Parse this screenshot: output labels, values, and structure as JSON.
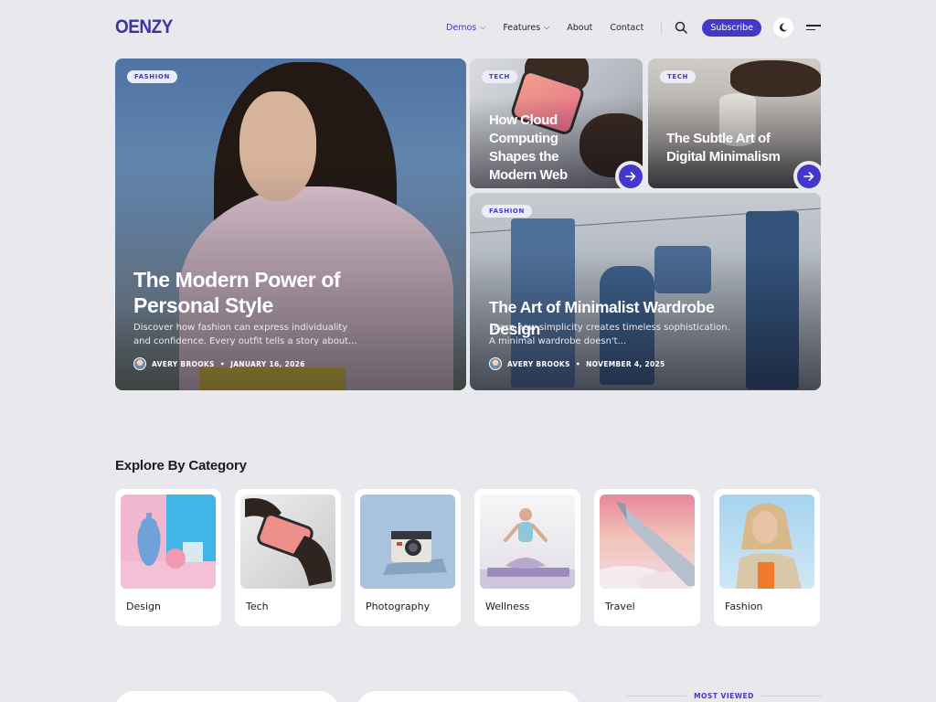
{
  "header": {
    "logo": "OENZY",
    "nav": [
      {
        "label": "Demos",
        "active": true,
        "has_dropdown": true
      },
      {
        "label": "Features",
        "active": false,
        "has_dropdown": true
      },
      {
        "label": "About",
        "active": false,
        "has_dropdown": false
      },
      {
        "label": "Contact",
        "active": false,
        "has_dropdown": false
      }
    ],
    "subscribe_label": "Subscribe",
    "icons": [
      "search-icon",
      "moon-icon",
      "menu-icon"
    ]
  },
  "hero": {
    "main": {
      "tag": "FASHION",
      "title": "The Modern Power of Personal Style",
      "excerpt": "Discover how fashion can express individuality and confidence. Every outfit tells a story about...",
      "author": "AVERY BROOKS",
      "date": "JANUARY 16, 2026"
    },
    "tech1": {
      "tag": "TECH",
      "title": "How Cloud Computing Shapes the Modern Web"
    },
    "tech2": {
      "tag": "TECH",
      "title": "The Subtle Art of Digital Minimalism"
    },
    "wardrobe": {
      "tag": "FASHION",
      "title": "The Art of Minimalist Wardrobe Design",
      "excerpt": "Learn how simplicity creates timeless sophistication. A minimal wardrobe doesn't...",
      "author": "AVERY BROOKS",
      "date": "NOVEMBER 4, 2025"
    }
  },
  "categories": {
    "title": "Explore By Category",
    "items": [
      {
        "label": "Design"
      },
      {
        "label": "Tech"
      },
      {
        "label": "Photography"
      },
      {
        "label": "Wellness"
      },
      {
        "label": "Travel"
      },
      {
        "label": "Fashion"
      }
    ]
  },
  "sidebar": {
    "most_viewed": "MOST VIEWED"
  },
  "colors": {
    "accent": "#4338ca",
    "background": "#e9e8ec",
    "tag_bg": "#ecebfa"
  }
}
